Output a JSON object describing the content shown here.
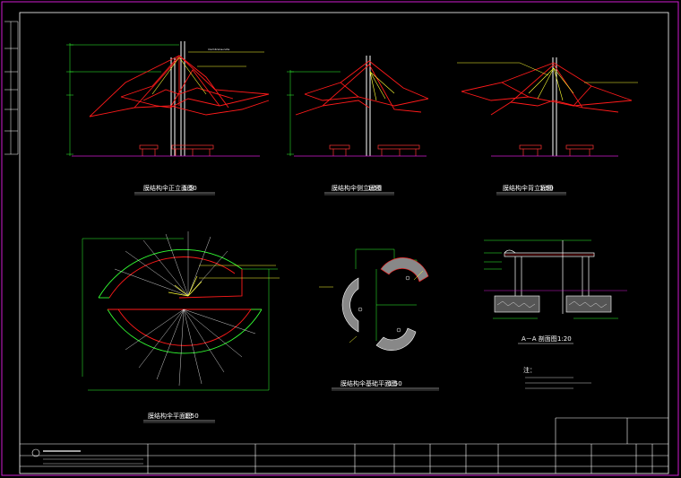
{
  "drawing": {
    "views": {
      "front_elevation_title": "膜结构伞正立面图",
      "front_elevation_scale": "1:50",
      "side_elevation_title": "膜结构伞侧立面图",
      "side_elevation_scale": "1:50",
      "back_elevation_title": "膜结构伞背立面图",
      "back_elevation_scale": "1:50",
      "roof_plan_title": "膜结构伞平面图",
      "roof_plan_scale": "1:50",
      "foundation_plan_title": "膜结构伞基础平面图",
      "foundation_plan_scale": "1:50",
      "section_title": "A－A 剖面图",
      "section_scale": "1:20",
      "notes_title": "注："
    }
  },
  "colors": {
    "background": "#000000",
    "sheet_border": "#d01bd0",
    "membrane": "#ff1a1a",
    "structure": "#ffffff",
    "accent": "#ffff33",
    "dimension": "#33ff33",
    "ground": "#d01bd0",
    "furniture": "#ff3333"
  }
}
